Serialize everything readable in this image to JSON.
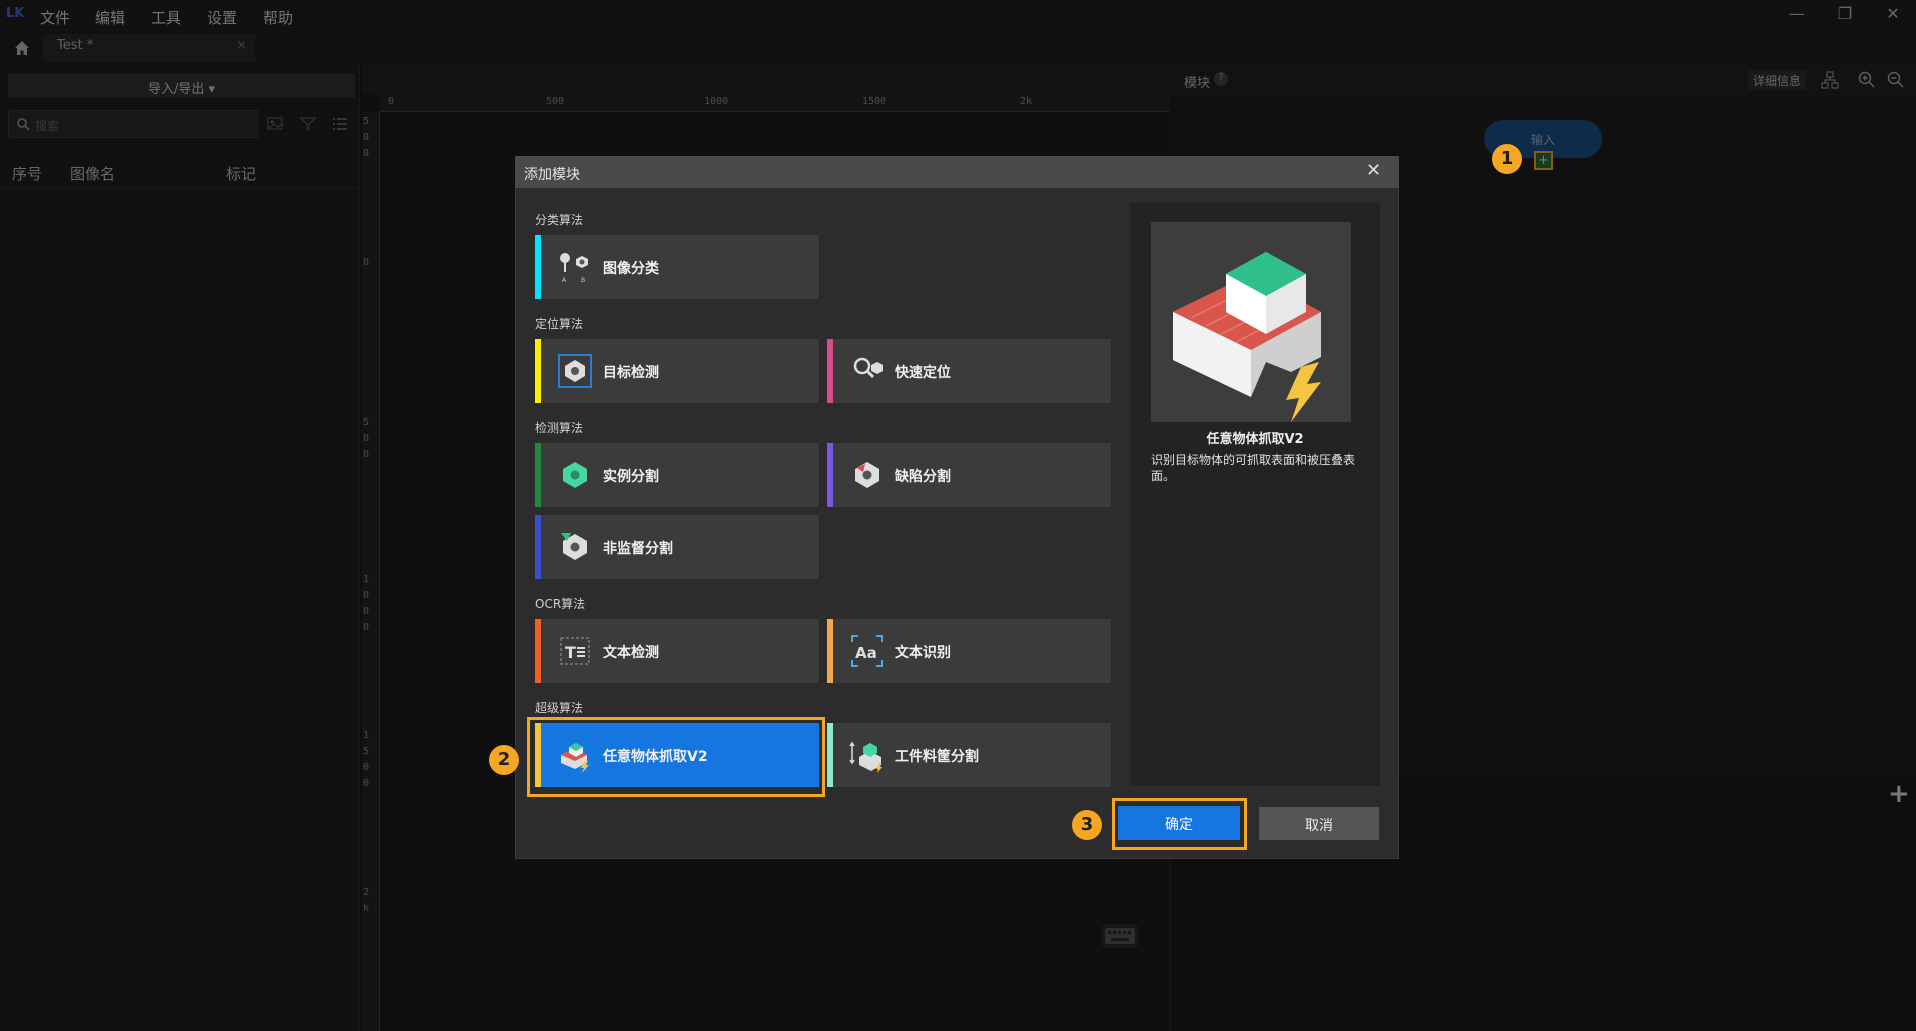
{
  "app": {
    "logo": "LK",
    "menu": [
      "文件",
      "编辑",
      "工具",
      "设置",
      "帮助"
    ],
    "tab": "Test *",
    "tab_close": "×",
    "window_controls": [
      "—",
      "❐",
      "✕"
    ]
  },
  "left": {
    "import_export": "导入/导出 ▾",
    "search_placeholder": "搜索",
    "col_index": "序号",
    "col_image": "图像名",
    "col_tag": "标记"
  },
  "ruler": {
    "h": [
      "0",
      "500",
      "1000",
      "1500",
      "2k"
    ],
    "v": [
      "5",
      "0",
      "0",
      "0",
      "5",
      "0",
      "0",
      "1",
      "0",
      "0",
      "0",
      "1",
      "5",
      "0",
      "0",
      "2",
      "k"
    ]
  },
  "right": {
    "title": "模块",
    "help": "?",
    "detail": "详细信息",
    "input_node": "输入",
    "plus": "+",
    "add": "+"
  },
  "dialog": {
    "title": "添加模块",
    "close": "✕",
    "sections": {
      "classify": "分类算法",
      "locate": "定位算法",
      "detect": "检测算法",
      "ocr": "OCR算法",
      "super": "超级算法"
    },
    "cards": {
      "image_classify": "图像分类",
      "object_detect": "目标检测",
      "fast_locate": "快速定位",
      "instance_seg": "实例分割",
      "defect_seg": "缺陷分割",
      "unsup_seg": "非监督分割",
      "text_detect": "文本检测",
      "text_recog": "文本识别",
      "grasp_v2": "任意物体抓取V2",
      "bin_seg": "工件料筐分割"
    },
    "preview_name": "任意物体抓取V2",
    "preview_desc": "识别目标物体的可抓取表面和被压叠表面。",
    "ok": "确定",
    "cancel": "取消"
  },
  "badges": [
    "1",
    "2",
    "3"
  ],
  "colors": {
    "accent": "#1676df",
    "highlight": "#f5a623",
    "cyan": "#00e5ff",
    "yellow": "#ffeb00",
    "pink": "#d94a8a",
    "green": "#1e8a3a",
    "purple": "#7a55e6",
    "blue": "#3a4fd0",
    "orange": "#f06020",
    "amber": "#f5a84a",
    "mint": "#8fe8c8"
  }
}
